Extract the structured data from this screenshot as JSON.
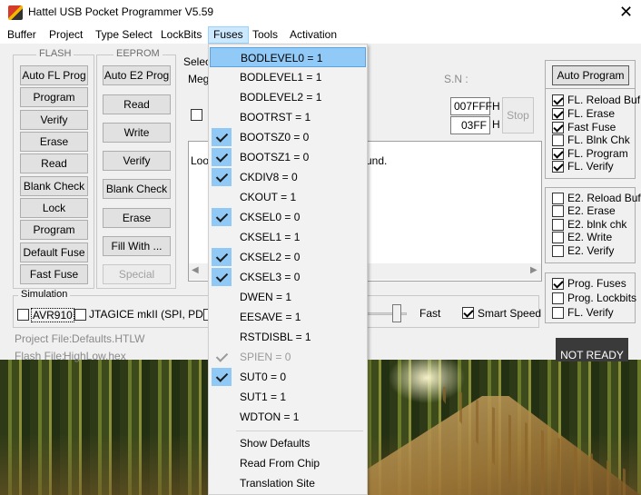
{
  "window": {
    "title": "Hattel USB Pocket Programmer V5.59",
    "close_glyph": "✕"
  },
  "menubar": [
    "Buffer",
    "Project",
    "Type Select",
    "LockBits",
    "Fuses",
    "Tools",
    "Activation"
  ],
  "flash": {
    "legend": "FLASH",
    "buttons": [
      "Auto FL Prog",
      "Program",
      "Verify",
      "Erase",
      "Read",
      "Blank Check",
      "Lock",
      "Program Fuse",
      "Default Fuse",
      "Fast Fuse"
    ]
  },
  "eeprom": {
    "legend": "EEPROM",
    "buttons": [
      "Auto E2 Prog",
      "Read",
      "Write",
      "Verify",
      "Blank Check",
      "Erase",
      "Fill With ...",
      "Special"
    ]
  },
  "device": {
    "select_label": "Selec",
    "mega_label": "Meg",
    "sn_label": "S.N :",
    "addr1": "007FFF",
    "addr2": "03FF",
    "h_label": "H",
    "stop_label": "Stop",
    "log_left": "Loo",
    "log_right": "und."
  },
  "right_panel": {
    "auto_program": "Auto Program",
    "group1": [
      {
        "label": "FL. Reload Buf",
        "checked": true
      },
      {
        "label": "FL. Erase",
        "checked": true
      },
      {
        "label": "Fast Fuse",
        "checked": true
      },
      {
        "label": "FL. Blnk Chk",
        "checked": false
      },
      {
        "label": "FL. Program",
        "checked": true
      },
      {
        "label": "FL. Verify",
        "checked": true
      }
    ],
    "group2": [
      {
        "label": "E2. Reload Buf",
        "checked": false
      },
      {
        "label": "E2. Erase",
        "checked": false
      },
      {
        "label": "E2. blnk chk",
        "checked": false
      },
      {
        "label": "E2. Write",
        "checked": false
      },
      {
        "label": "E2. Verify",
        "checked": false
      }
    ],
    "group3": [
      {
        "label": "Prog. Fuses",
        "checked": true
      },
      {
        "label": "Prog. Lockbits",
        "checked": false
      },
      {
        "label": "FL. Verify",
        "checked": false
      }
    ]
  },
  "simulation": {
    "legend": "Simulation",
    "avr910": "AVR910",
    "jtagice": "JTAGICE mkII (SPI, PDI)",
    "fast": "Fast",
    "smart_speed": "Smart Speed",
    "smart_speed_checked": true
  },
  "footer": {
    "project_file_label": "Project File:",
    "project_file_value": "Defaults.HTLW",
    "flash_file_label": "Flash File:",
    "flash_file_value": "HighLow.hex",
    "status": "NOT READY"
  },
  "fuses_menu": {
    "items": [
      {
        "label": "BODLEVEL0 = 1",
        "checked": false,
        "highlighted": true,
        "disabled": false
      },
      {
        "label": "BODLEVEL1 = 1",
        "checked": false,
        "highlighted": false,
        "disabled": false
      },
      {
        "label": "BODLEVEL2 = 1",
        "checked": false,
        "highlighted": false,
        "disabled": false
      },
      {
        "label": "BOOTRST = 1",
        "checked": false,
        "highlighted": false,
        "disabled": false
      },
      {
        "label": "BOOTSZ0 = 0",
        "checked": true,
        "highlighted": false,
        "disabled": false
      },
      {
        "label": "BOOTSZ1 = 0",
        "checked": true,
        "highlighted": false,
        "disabled": false
      },
      {
        "label": "CKDIV8 = 0",
        "checked": true,
        "highlighted": false,
        "disabled": false
      },
      {
        "label": "CKOUT = 1",
        "checked": false,
        "highlighted": false,
        "disabled": false
      },
      {
        "label": "CKSEL0 = 0",
        "checked": true,
        "highlighted": false,
        "disabled": false
      },
      {
        "label": "CKSEL1 = 1",
        "checked": false,
        "highlighted": false,
        "disabled": false
      },
      {
        "label": "CKSEL2 = 0",
        "checked": true,
        "highlighted": false,
        "disabled": false
      },
      {
        "label": "CKSEL3 = 0",
        "checked": true,
        "highlighted": false,
        "disabled": false
      },
      {
        "label": "DWEN = 1",
        "checked": false,
        "highlighted": false,
        "disabled": false
      },
      {
        "label": "EESAVE = 1",
        "checked": false,
        "highlighted": false,
        "disabled": false
      },
      {
        "label": "RSTDISBL = 1",
        "checked": false,
        "highlighted": false,
        "disabled": false
      },
      {
        "label": "SPIEN = 0",
        "checked": true,
        "highlighted": false,
        "disabled": true
      },
      {
        "label": "SUT0 = 0",
        "checked": true,
        "highlighted": false,
        "disabled": false
      },
      {
        "label": "SUT1 = 1",
        "checked": false,
        "highlighted": false,
        "disabled": false
      },
      {
        "label": "WDTON = 1",
        "checked": false,
        "highlighted": false,
        "disabled": false
      }
    ],
    "actions": [
      "Show Defaults",
      "Read From Chip",
      "Translation Site"
    ]
  }
}
